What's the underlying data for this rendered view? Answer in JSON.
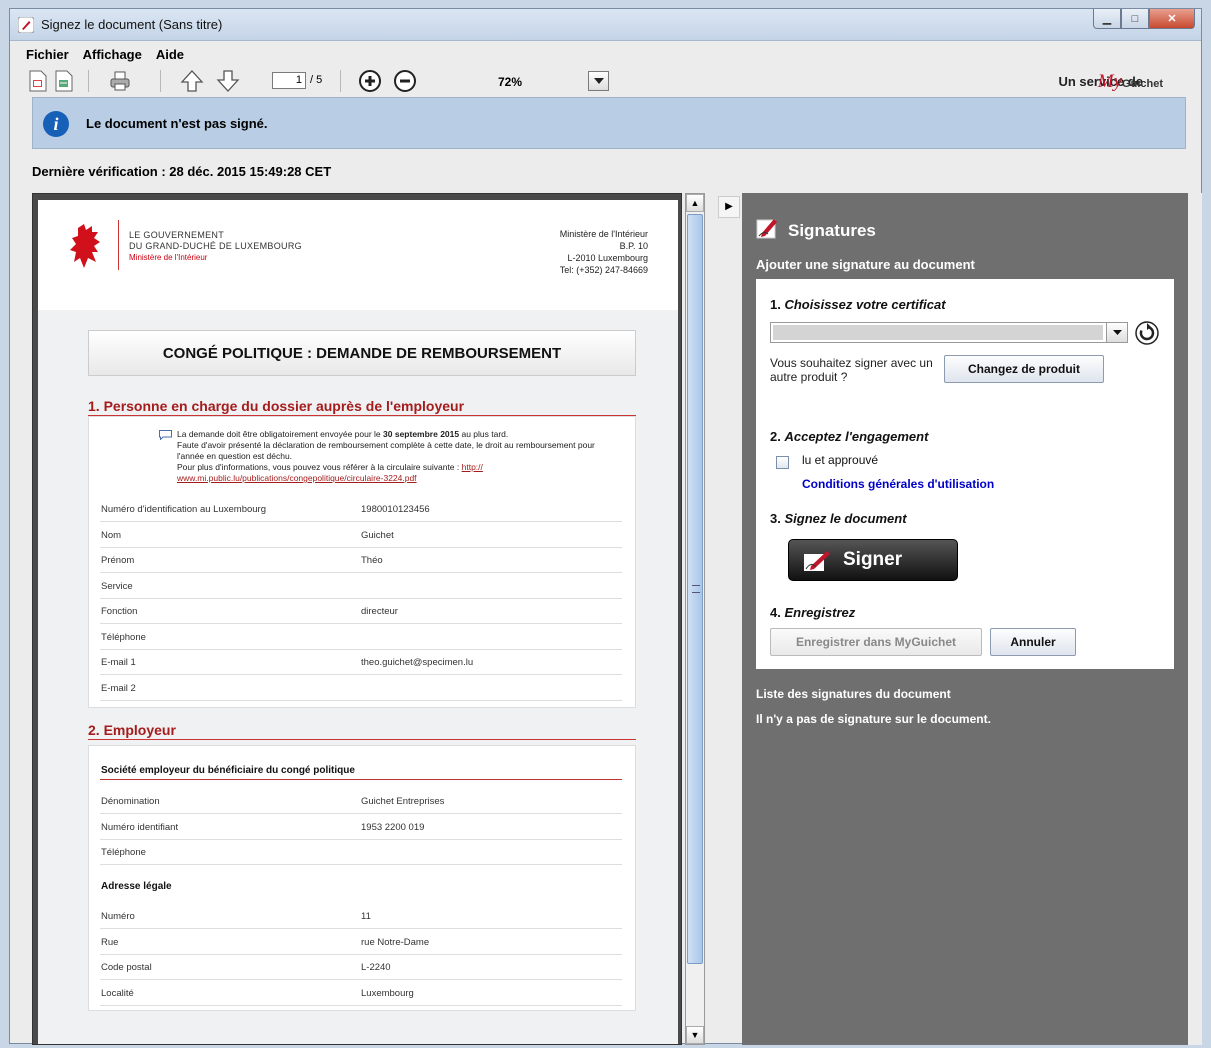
{
  "window": {
    "title": "Signez le document (Sans titre)"
  },
  "menu": {
    "items": [
      "Fichier",
      "Affichage",
      "Aide"
    ]
  },
  "toolbar": {
    "page_current": "1",
    "page_total": "/ 5",
    "zoom": "72%",
    "service_label": "Un service de",
    "logo_my": "My",
    "logo_guichet": "Guichet"
  },
  "info": {
    "message": "Le document n'est pas signé."
  },
  "last_check": "Dernière vérification : 28 déc. 2015 15:49:28 CET",
  "document": {
    "gov_line1": "LE GOUVERNEMENT",
    "gov_line2": "DU GRAND-DUCHÉ DE LUXEMBOURG",
    "gov_line3": "Ministère de l'Intérieur",
    "address": [
      "Ministère de l'Intérieur",
      "B.P. 10",
      "L-2010 Luxembourg",
      "Tel: (+352) 247-84669"
    ],
    "title": "CONGÉ POLITIQUE : DEMANDE DE REMBOURSEMENT",
    "section1_title": "1. Personne en charge du dossier auprès de l'employeur",
    "notice_pre": "La demande doit être obligatoirement envoyée pour le ",
    "notice_date": "30 septembre 2015",
    "notice_post": " au plus tard.",
    "notice_line2": "Faute d'avoir présenté la déclaration de remboursement complète à cette date, le droit au remboursement pour l'année en question est déchu.",
    "notice_line3": "Pour plus d'informations, vous pouvez vous référer à la circulaire suivante : ",
    "notice_link": "http:// www.mi.public.lu/publications/congepolitique/circulaire-3224.pdf",
    "section1_rows": [
      {
        "label": "Numéro d'identification au Luxembourg",
        "value": "1980010123456"
      },
      {
        "label": "Nom",
        "value": "Guichet"
      },
      {
        "label": "Prénom",
        "value": "Théo"
      },
      {
        "label": "Service",
        "value": ""
      },
      {
        "label": "Fonction",
        "value": "directeur"
      },
      {
        "label": "Téléphone",
        "value": ""
      },
      {
        "label": "E-mail 1",
        "value": "theo.guichet@specimen.lu"
      },
      {
        "label": "E-mail 2",
        "value": ""
      }
    ],
    "section2_title": "2. Employeur",
    "section2_subhead": "Société employeur du bénéficiaire du congé politique",
    "section2_rows": [
      {
        "label": "Dénomination",
        "value": "Guichet Entreprises"
      },
      {
        "label": "Numéro identifiant",
        "value": "1953 2200 019"
      },
      {
        "label": "Téléphone",
        "value": ""
      }
    ],
    "address_subhead": "Adresse légale",
    "address_rows": [
      {
        "label": "Numéro",
        "value": "11"
      },
      {
        "label": "Rue",
        "value": "rue Notre-Dame"
      },
      {
        "label": "Code postal",
        "value": "L-2240"
      },
      {
        "label": "Localité",
        "value": "Luxembourg"
      }
    ]
  },
  "signatures": {
    "title": "Signatures",
    "add_label": "Ajouter une signature au document",
    "step1_num": "1.",
    "step1": "Choisissez votre certificat",
    "alt_product": "Vous souhaitez signer avec un autre produit ?",
    "change_product": "Changez de produit",
    "step2_num": "2.",
    "step2": "Acceptez l'engagement",
    "accept_label": "lu et approuvé",
    "cgu": "Conditions générales d'utilisation",
    "step3_num": "3.",
    "step3": "Signez le document",
    "sign_button": "Signer",
    "step4_num": "4.",
    "step4": "Enregistrez",
    "save_button": "Enregistrer dans MyGuichet",
    "cancel_button": "Annuler",
    "list_title": "Liste des signatures du document",
    "no_signature": "Il n'y a pas de signature sur le document."
  }
}
